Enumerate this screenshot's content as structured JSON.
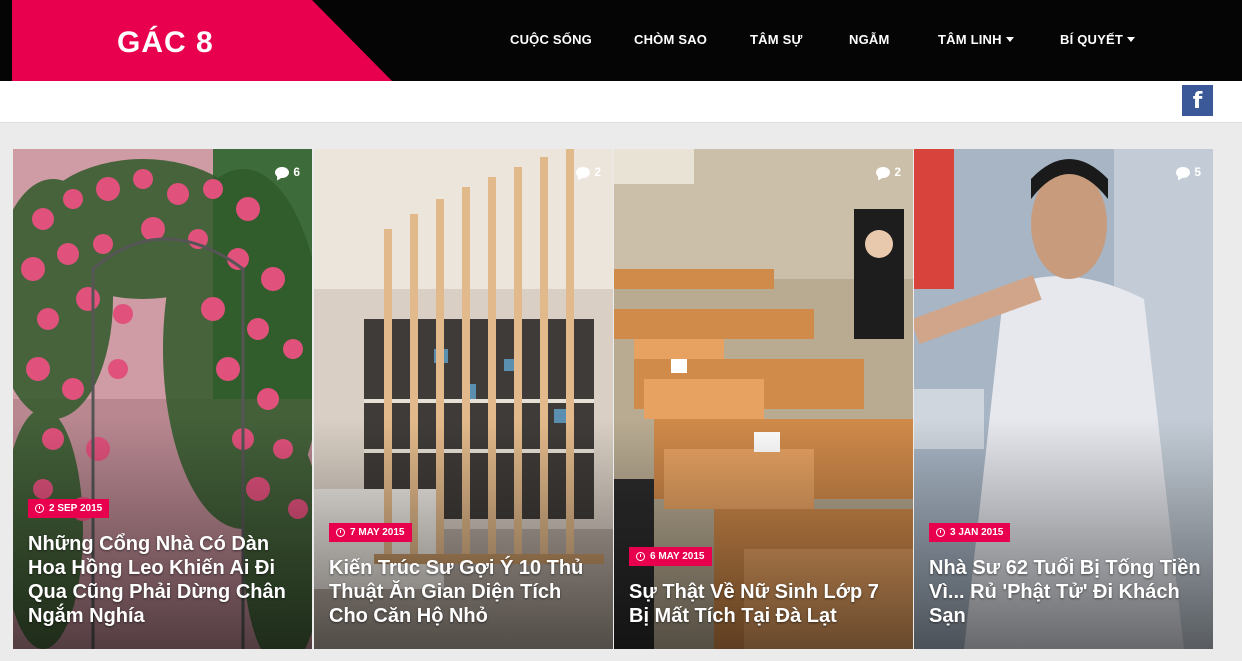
{
  "site": {
    "logo": "GÁC 8"
  },
  "nav": {
    "items": [
      {
        "label": "CUỘC SỐNG"
      },
      {
        "label": "CHÒM SAO"
      },
      {
        "label": "TÂM SỰ"
      },
      {
        "label": "NGẪM"
      },
      {
        "label": "TÂM LINH"
      },
      {
        "label": "BÍ QUYẾT"
      }
    ]
  },
  "social": {
    "facebook": "f"
  },
  "posts": [
    {
      "comments": "6",
      "date": "2 SEP 2015",
      "title": "Những Cổng Nhà Có Dàn Hoa Hồng Leo Khiến Ai Đi Qua Cũng Phải Dừng Chân Ngắm Nghía"
    },
    {
      "comments": "2",
      "date": "7 MAY 2015",
      "title": "Kiến Trúc Sư Gợi Ý 10 Thủ Thuật Ăn Gian Diện Tích Cho Căn Hộ Nhỏ"
    },
    {
      "comments": "2",
      "date": "6 MAY 2015",
      "title": "Sự Thật Về Nữ Sinh Lớp 7 Bị Mất Tích Tại Đà Lạt"
    },
    {
      "comments": "5",
      "date": "3 JAN 2015",
      "title": "Nhà Sư 62 Tuổi Bị Tống Tiền Vì... Rủ 'Phật Tử' Đi Khách Sạn"
    }
  ],
  "colors": {
    "accent": "#e8004f",
    "topbar": "#050505",
    "facebook": "#3b5998"
  }
}
